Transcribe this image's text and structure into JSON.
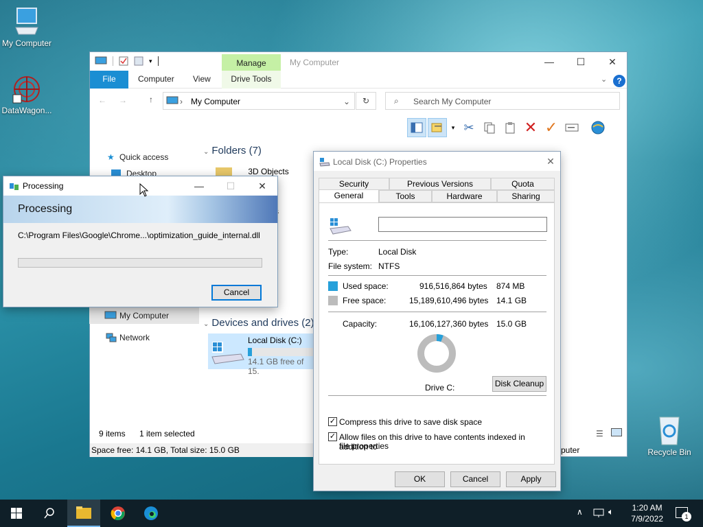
{
  "desktop": {
    "icons": [
      {
        "label": "My Computer",
        "icon": "computer-icon"
      },
      {
        "label": "DataWagon...",
        "icon": "datawagon-icon"
      },
      {
        "label": "Recycle Bin",
        "icon": "recycle-bin-icon"
      }
    ]
  },
  "explorer": {
    "title": "My Computer",
    "manage_tab": "Manage",
    "tabs": [
      "File",
      "Computer",
      "View",
      "Drive Tools"
    ],
    "address": "My Computer",
    "search_placeholder": "Search My Computer",
    "folders_header": "Folders (7)",
    "devices_header": "Devices and drives (2)",
    "folder_items": [
      "3D Objects",
      "nts"
    ],
    "nav": [
      "Quick access",
      "Desktop",
      "My Computer",
      "Network"
    ],
    "drive": {
      "name": "Local Disk (C:)",
      "free_text": "14.1 GB free of 15.",
      "used_fraction": 0.058
    },
    "right_item": "puter",
    "status_items": "9 items",
    "status_selected": "1 item selected",
    "status_space": "Space free: 14.1 GB, Total size: 15.0 GB"
  },
  "processing": {
    "title": "Processing",
    "banner": "Processing",
    "path": "C:\\Program Files\\Google\\Chrome...\\optimization_guide_internal.dll",
    "progress": 0,
    "cancel": "Cancel"
  },
  "properties": {
    "title": "Local Disk (C:) Properties",
    "tabs_row1": [
      "Security",
      "Previous Versions",
      "Quota"
    ],
    "tabs_row2": [
      "General",
      "Tools",
      "Hardware",
      "Sharing"
    ],
    "name_value": "",
    "type_label": "Type:",
    "type_value": "Local Disk",
    "fs_label": "File system:",
    "fs_value": "NTFS",
    "used_label": "Used space:",
    "used_bytes": "916,516,864 bytes",
    "used_size": "874 MB",
    "free_label": "Free space:",
    "free_bytes": "15,189,610,496 bytes",
    "free_size": "14.1 GB",
    "cap_label": "Capacity:",
    "cap_bytes": "16,106,127,360 bytes",
    "cap_size": "15.0 GB",
    "drive_label": "Drive C:",
    "cleanup": "Disk Cleanup",
    "compress": "Compress this drive to save disk space",
    "index_line1": "Allow files on this drive to have contents indexed in addition to",
    "index_line2": "file properties",
    "ok": "OK",
    "cancel": "Cancel",
    "apply": "Apply",
    "used_color": "#26a0da",
    "free_color": "#bcbcbc",
    "used_fraction": 0.057
  },
  "taskbar": {
    "time": "1:20 AM",
    "date": "7/9/2022",
    "notification_count": "1"
  }
}
